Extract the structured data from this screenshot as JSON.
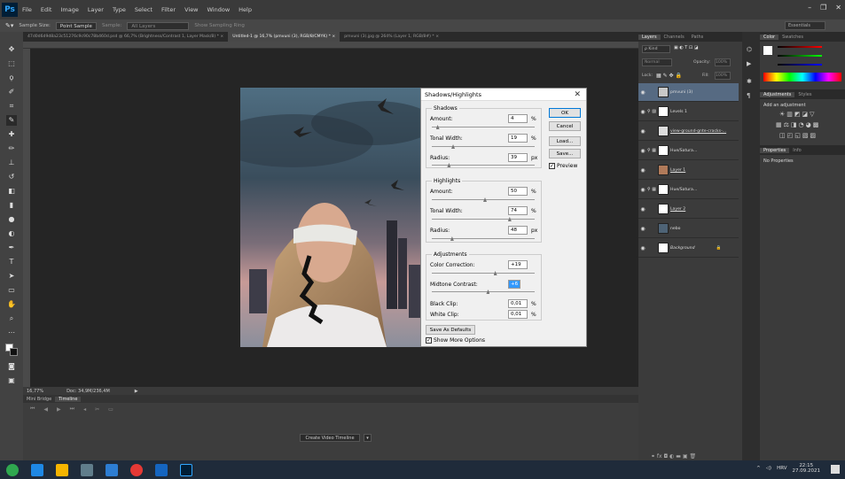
{
  "app": {
    "logo": "Ps"
  },
  "menubar": {
    "items": [
      "File",
      "Edit",
      "Image",
      "Layer",
      "Type",
      "Select",
      "Filter",
      "View",
      "Window",
      "Help"
    ],
    "window_controls": [
      "–",
      "❐",
      "✕"
    ]
  },
  "options_bar": {
    "sample_size_label": "Sample Size:",
    "sample_size_value": "Point Sample",
    "sample_label": "Sample:",
    "sample_value": "All Layers",
    "show_ring": "Show Sampling Ring",
    "workspace": "Essentials"
  },
  "doc_tabs": [
    "47d0d6d9d8a23c51276c9c90c78b460d.psd @ 66,7% (Brightness/Contrast 1, Layer Mask/8) * ×",
    "Untitled-1 @ 16,7% (pmvuni (3), RGB/8/CMYK) * ×",
    "pmvuni (3).jpg @ 264% (Layer 1, RGB/8#) * ×"
  ],
  "status": {
    "zoom": "16,77%",
    "doc": "Doc: 34,9M/236,4M"
  },
  "timeline": {
    "tabs": [
      "Mini Bridge",
      "Timeline"
    ],
    "create_button": "Create Video Timeline",
    "create_dropdown": "▾"
  },
  "layers_panel": {
    "tabs": [
      "Layers",
      "Channels",
      "Paths"
    ],
    "kind_label": "ρ Kind",
    "blend_mode": "Normal",
    "opacity_label": "Opacity:",
    "opacity_value": "100%",
    "lock_label": "Lock:",
    "fill_label": "Fill:",
    "fill_value": "100%",
    "layers": [
      {
        "name": "pmvuni (3)",
        "selected": true
      },
      {
        "name": "Levels 1",
        "selected": false
      },
      {
        "name": "view-ground-gnte-cracks-...",
        "selected": false
      },
      {
        "name": "Hue/Satura...",
        "selected": false
      },
      {
        "name": "Layer 1",
        "selected": false
      },
      {
        "name": "Hue/Satura...",
        "selected": false
      },
      {
        "name": "Layer 2",
        "selected": false
      },
      {
        "name": "nebo",
        "selected": false
      },
      {
        "name": "Background",
        "selected": false
      }
    ]
  },
  "right_panel": {
    "color_tabs": [
      "Color",
      "Swatches"
    ],
    "adjust_tabs": [
      "Adjustments",
      "Styles"
    ],
    "adjust_heading": "Add an adjustment",
    "props_tabs": [
      "Properties",
      "Info"
    ],
    "no_properties": "No Properties"
  },
  "dialog": {
    "title": "Shadows/Highlights",
    "close": "✕",
    "shadows": {
      "label": "Shadows",
      "amount_label": "Amount:",
      "amount": "4",
      "amount_unit": "%",
      "amount_level": 0.04,
      "tonal_label": "Tonal Width:",
      "tonal": "19",
      "tonal_unit": "%",
      "tonal_level": 0.19,
      "radius_label": "Radius:",
      "radius": "39",
      "radius_unit": "px",
      "radius_level": 0.15
    },
    "highlights": {
      "label": "Highlights",
      "amount_label": "Amount:",
      "amount": "50",
      "amount_unit": "%",
      "amount_level": 0.5,
      "tonal_label": "Tonal Width:",
      "tonal": "74",
      "tonal_unit": "%",
      "tonal_level": 0.74,
      "radius_label": "Radius:",
      "radius": "48",
      "radius_unit": "px",
      "radius_level": 0.18
    },
    "adjustments": {
      "label": "Adjustments",
      "color_label": "Color Correction:",
      "color": "+19",
      "color_level": 0.6,
      "midtone_label": "Midtone Contrast:",
      "midtone": "+6",
      "midtone_level": 0.53,
      "black_label": "Black Clip:",
      "black": "0,01",
      "black_unit": "%",
      "white_label": "White Clip:",
      "white": "0,01",
      "white_unit": "%"
    },
    "buttons": {
      "ok": "OK",
      "cancel": "Cancel",
      "load": "Load...",
      "save": "Save..."
    },
    "preview_label": "Preview",
    "save_defaults": "Save As Defaults",
    "show_more": "Show More Options"
  },
  "taskbar": {
    "tray_lang": "HRV",
    "time": "22:15",
    "date": "27.09.2021"
  },
  "colors": {
    "selected_layer": "#566a82",
    "ps_blue": "#31a8ff",
    "taskbar": "#1f2b3a"
  }
}
